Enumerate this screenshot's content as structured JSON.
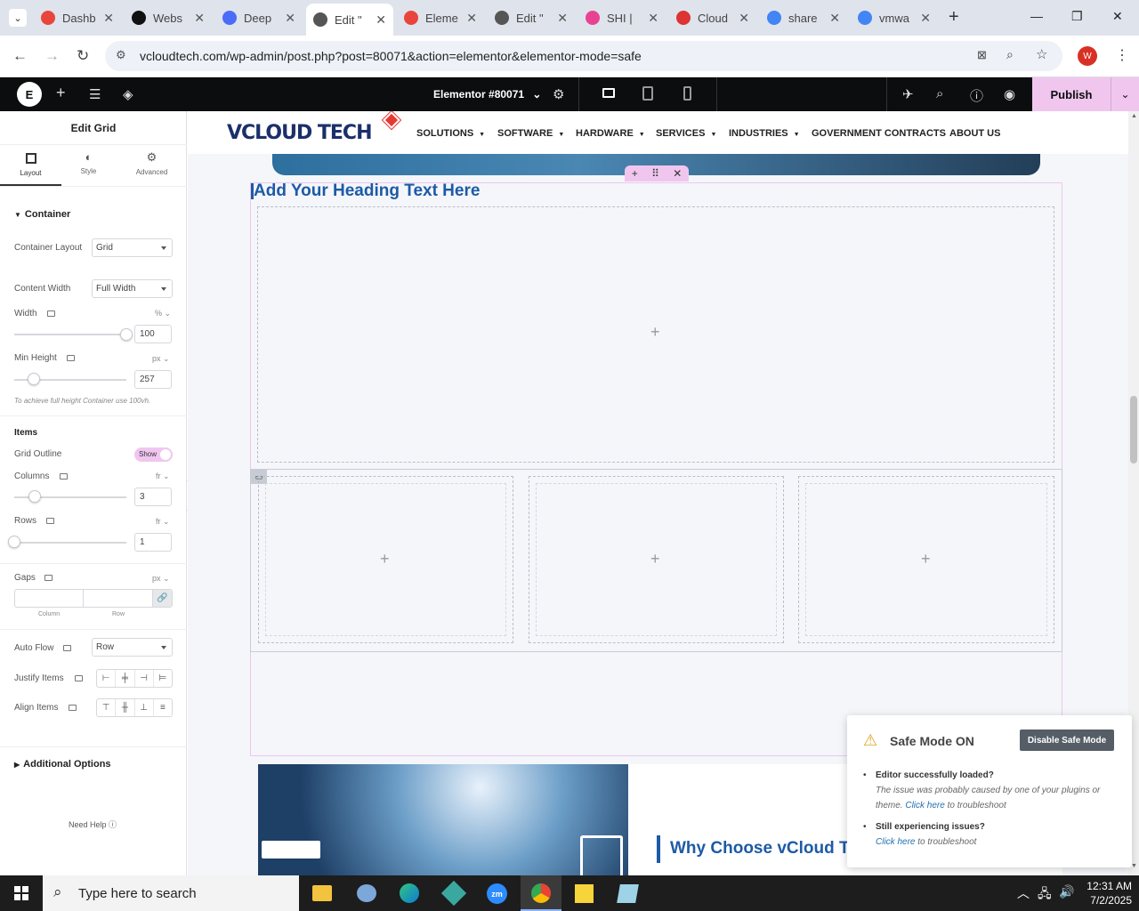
{
  "browser": {
    "tabs": [
      {
        "label": "Dashb",
        "color": "#e8453c"
      },
      {
        "label": "Webs",
        "color": "#111111"
      },
      {
        "label": "Deep",
        "color": "#4a6cf7"
      },
      {
        "label": "Edit \"",
        "color": "#555555"
      },
      {
        "label": "Eleme",
        "color": "#e8453c"
      },
      {
        "label": "Edit \"",
        "color": "#555555"
      },
      {
        "label": "SHI |",
        "color": "#e84393"
      },
      {
        "label": "Cloud",
        "color": "#d33"
      },
      {
        "label": "share",
        "color": "#4285f4"
      },
      {
        "label": "vmwa",
        "color": "#4285f4"
      }
    ],
    "active_tab": 3,
    "url": "vcloudtech.com/wp-admin/post.php?post=80071&action=elementor&elementor-mode=safe",
    "profile_initial": "W"
  },
  "topbar": {
    "document_title": "Elementor #80071",
    "publish_label": "Publish"
  },
  "panel": {
    "title": "Edit Grid",
    "tabs": [
      "Layout",
      "Style",
      "Advanced"
    ],
    "section_container": "Container",
    "container_layout_label": "Container Layout",
    "container_layout_value": "Grid",
    "content_width_label": "Content Width",
    "content_width_value": "Full Width",
    "width_label": "Width",
    "width_unit": "% ⌄",
    "width_value": "100",
    "min_height_label": "Min Height",
    "min_height_unit": "px ⌄",
    "min_height_value": "257",
    "min_height_hint": "To achieve full height Container use 100vh.",
    "items_heading": "Items",
    "grid_outline_label": "Grid Outline",
    "grid_outline_value": "Show",
    "columns_label": "Columns",
    "columns_unit": "fr ⌄",
    "columns_value": "3",
    "rows_label": "Rows",
    "rows_unit": "fr ⌄",
    "rows_value": "1",
    "gaps_label": "Gaps",
    "gaps_unit": "px ⌄",
    "gaps_column": "Column",
    "gaps_row": "Row",
    "auto_flow_label": "Auto Flow",
    "auto_flow_value": "Row",
    "justify_items_label": "Justify Items",
    "align_items_label": "Align Items",
    "additional_options": "Additional Options",
    "need_help": "Need Help"
  },
  "site": {
    "logo_text": "VCLOUD TECH",
    "menu": [
      "SOLUTIONS",
      "SOFTWARE",
      "HARDWARE",
      "SERVICES",
      "INDUSTRIES",
      "GOVERNMENT CONTRACTS",
      "ABOUT US"
    ],
    "menu_has_dropdown": [
      true,
      true,
      true,
      true,
      true,
      false,
      false
    ],
    "heading": "Add Your Heading Text Here",
    "why_heading": "Why Choose vCloud T"
  },
  "safe_mode": {
    "title": "Safe Mode ON",
    "button": "Disable Safe Mode",
    "item1_title": "Editor successfully loaded?",
    "item1_text": "The issue was probably caused by one of your plugins or theme.",
    "item1_link": "Click here",
    "item1_suffix": "to troubleshoot",
    "item2_title": "Still experiencing issues?",
    "item2_link": "Click here",
    "item2_suffix": "to troubleshoot"
  },
  "taskbar": {
    "search_placeholder": "Type here to search",
    "time": "12:31 AM",
    "date": "7/2/2025"
  },
  "colors": {
    "accent_pink": "#f0c6ef",
    "heading_blue": "#1d5aa6",
    "editor_dark": "#0c0d0e"
  }
}
